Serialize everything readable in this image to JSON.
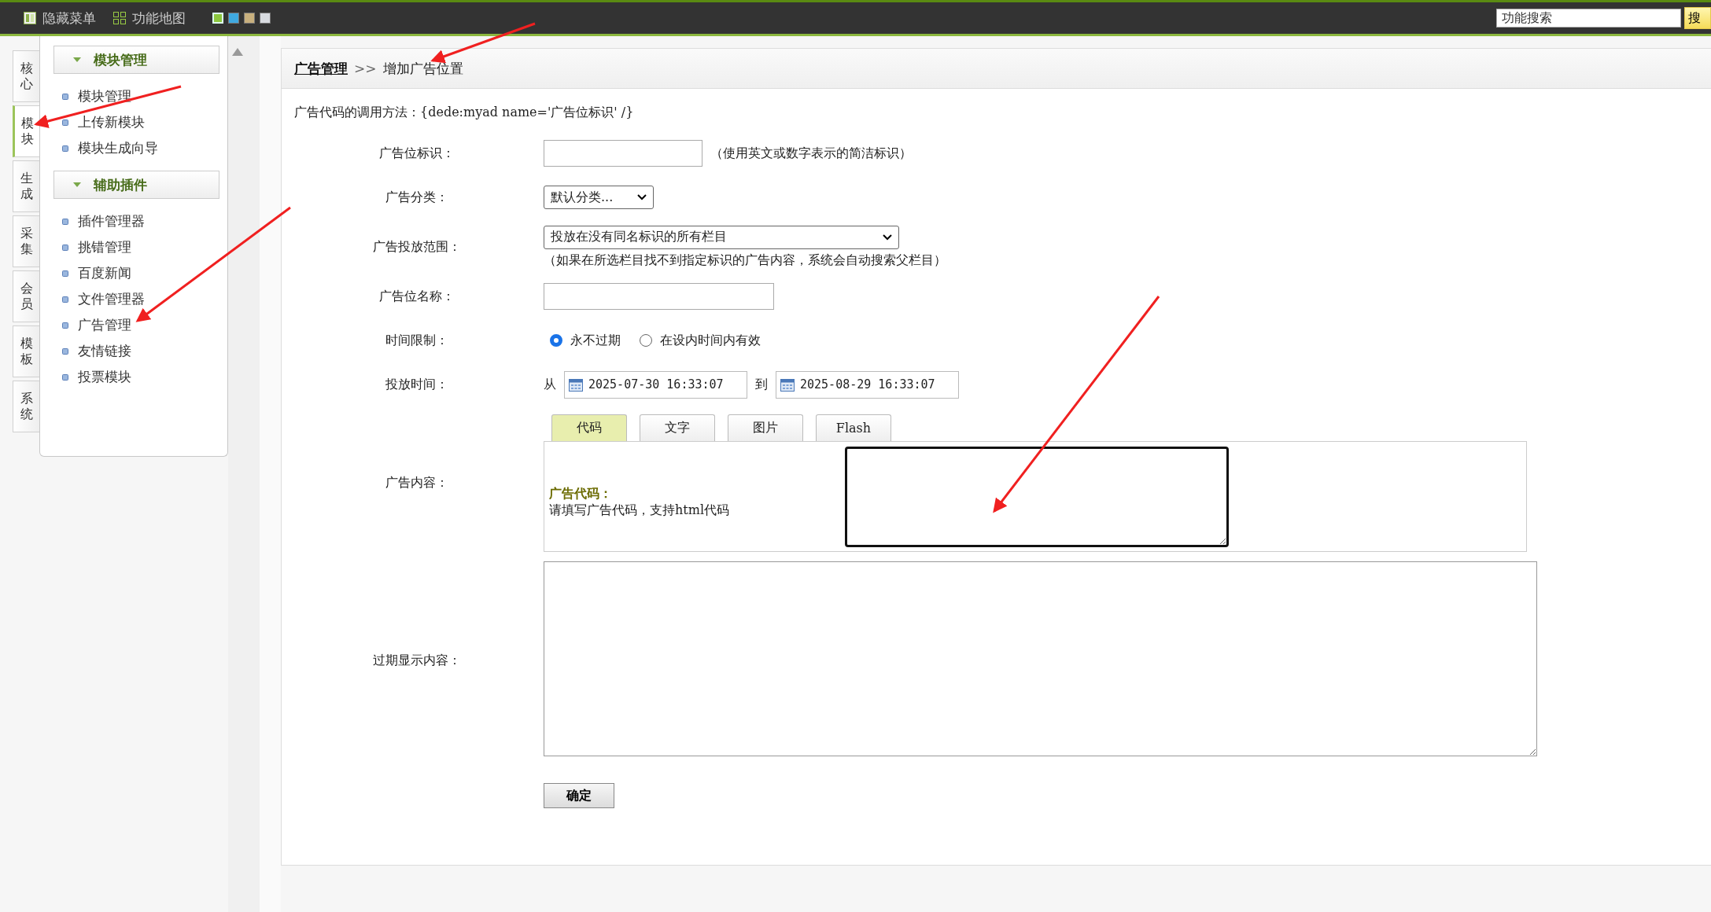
{
  "top_bar": {
    "items": [
      {
        "label": "隐藏菜单",
        "kind": "panel"
      },
      {
        "label": "功能地图",
        "kind": "grid"
      }
    ],
    "themes": [
      {
        "color": "#8cc63e",
        "selected": true
      },
      {
        "color": "#3fa9e0",
        "selected": false
      },
      {
        "color": "#c8b07e",
        "selected": false
      },
      {
        "color": "#d8dbe0",
        "selected": false
      }
    ],
    "search": {
      "value": "功能搜索",
      "button": "搜"
    }
  },
  "side_tabs": [
    {
      "label": "核心",
      "selected": false
    },
    {
      "label": "模块",
      "selected": true
    },
    {
      "label": "生成",
      "selected": false
    },
    {
      "label": "采集",
      "selected": false
    },
    {
      "label": "会员",
      "selected": false
    },
    {
      "label": "模板",
      "selected": false
    },
    {
      "label": "系统",
      "selected": false
    }
  ],
  "menu": [
    {
      "title": "模块管理",
      "expanded": true,
      "items": [
        "模块管理",
        "上传新模块",
        "模块生成向导"
      ]
    },
    {
      "title": "辅助插件",
      "expanded": true,
      "items": [
        "插件管理器",
        "挑错管理",
        "百度新闻",
        "文件管理器",
        "广告管理",
        "友情链接",
        "投票模块"
      ]
    }
  ],
  "breadcrumb": {
    "link": "广告管理",
    "separator": ">>",
    "current": "增加广告位置"
  },
  "form": {
    "note": "广告代码的调用方法：{dede:myad name='广告位标识' /}",
    "rows": [
      {
        "kind": "text",
        "label": "广告位标识：",
        "hint": "（使用英文或数字表示的简洁标识）"
      },
      {
        "kind": "select",
        "label": "广告分类：",
        "value": "默认分类..."
      },
      {
        "kind": "select",
        "label": "广告投放范围：",
        "value": "投放在没有同名标识的所有栏目",
        "hint": "（如果在所选栏目找不到指定标识的广告内容，系统会自动搜索父栏目）"
      },
      {
        "kind": "text",
        "label": "广告位名称："
      },
      {
        "kind": "radio",
        "label": "时间限制：",
        "options": [
          {
            "label": "永不过期",
            "selected": true
          },
          {
            "label": "在设内时间内有效",
            "selected": false
          }
        ]
      },
      {
        "kind": "daterange",
        "label": "投放时间：",
        "from_label": "从",
        "from": "2025-07-30 16:33:07",
        "to_label": "到",
        "to": "2025-08-29 16:33:07"
      },
      {
        "kind": "tabs",
        "label": "广告内容：",
        "tabs": [
          {
            "label": "代码",
            "selected": true
          },
          {
            "label": "文字",
            "selected": false
          },
          {
            "label": "图片",
            "selected": false
          },
          {
            "label": "Flash",
            "selected": false
          }
        ],
        "panel_title": "广告代码：",
        "panel_text": "请填写广告代码，支持html代码"
      },
      {
        "kind": "textarea",
        "label": "过期显示内容："
      }
    ],
    "submit": "确定"
  }
}
